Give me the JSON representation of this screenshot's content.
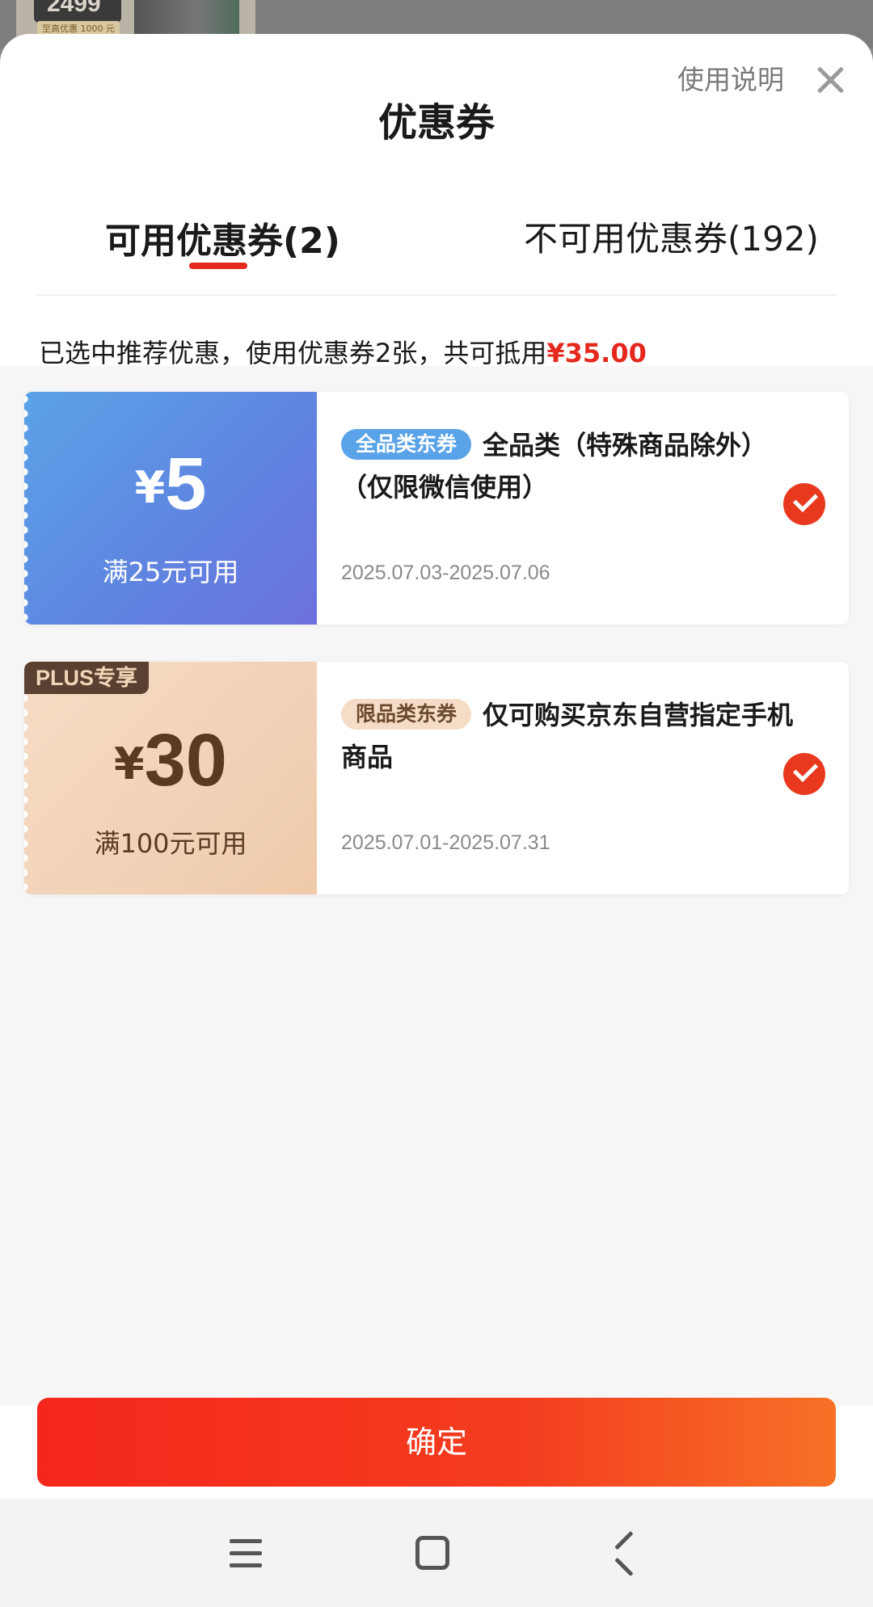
{
  "backdrop": {
    "price": "2499",
    "price_sub": "至高优惠 1000 元"
  },
  "sheet": {
    "title": "优惠券",
    "help_link": "使用说明"
  },
  "tabs": [
    {
      "label": "可用优惠券(2)",
      "active": true
    },
    {
      "label": "不可用优惠券(192)",
      "active": false
    }
  ],
  "summary": {
    "text": "已选中推荐优惠，使用优惠券2张，共可抵用",
    "amount": "¥35.00"
  },
  "coupons": [
    {
      "currency": "¥",
      "amount": "5",
      "condition": "满25元可用",
      "tag": "全品类东券",
      "description": "全品类（特殊商品除外）（仅限微信使用）",
      "date_range": "2025.07.03-2025.07.06",
      "selected": true,
      "theme_color": "#5f86e0"
    },
    {
      "badge": "PLUS专享",
      "currency": "¥",
      "amount": "30",
      "condition": "满100元可用",
      "tag": "限品类东券",
      "description": "仅可购买京东自营指定手机商品",
      "date_range": "2025.07.01-2025.07.31",
      "selected": true,
      "theme_color": "#f2d2b7"
    }
  ],
  "footer": {
    "confirm_label": "确定"
  },
  "colors": {
    "accent": "#e4281d",
    "button_gradient_start": "#f4271c",
    "button_gradient_end": "#f77126"
  },
  "system_nav": {
    "icons": [
      "menu-icon",
      "home-icon",
      "back-icon"
    ]
  }
}
